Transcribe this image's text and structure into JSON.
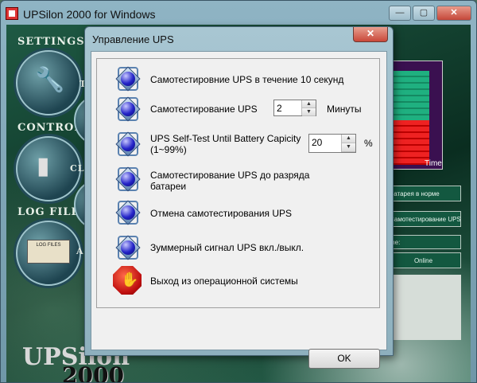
{
  "main_window": {
    "title": "UPSilon 2000 for Windows",
    "buttons": {
      "minimize": "—",
      "maximize": "▢",
      "close": "✕"
    },
    "sidebar": [
      {
        "label": "SETTINGS",
        "icon": "wrench-icon"
      },
      {
        "label": "CONTROL",
        "icon": "remote-icon"
      },
      {
        "label": "LOG FILE",
        "icon": "log-files-icon",
        "sub": "LOG FILES"
      }
    ],
    "partial_labels": [
      "T",
      "CLO",
      "A"
    ],
    "logo": {
      "name": "UPSilon",
      "year": "2000"
    },
    "right_panel": {
      "gauge_time": "Time",
      "battery_status": "Батарея в норме",
      "self_test": "Самотестирование UPS",
      "line_label": "me:",
      "online": "Online"
    }
  },
  "dialog": {
    "title": "Управление UPS",
    "close_label": "✕",
    "rows": [
      {
        "text": "Самотестировние UPS в течение 10 секунд"
      },
      {
        "text": "Самотестирование UPS",
        "spin_value": "2",
        "unit": "Минуты"
      },
      {
        "text": "UPS Self-Test Until Battery Capicity (1~99%)",
        "spin_value": "20",
        "unit": "%"
      },
      {
        "text": "Самотестирование UPS до разряда батареи"
      },
      {
        "text": "Отмена самотестирования UPS"
      },
      {
        "text": "Зуммерный сигнал UPS вкл./выкл."
      },
      {
        "text": "Выход из операционной системы"
      }
    ],
    "ok_label": "OK"
  },
  "colors": {
    "accent": "#8eb0be",
    "background": "#0c3d2c",
    "gauge_green": "#1fb080",
    "gauge_red": "#ee2222"
  }
}
